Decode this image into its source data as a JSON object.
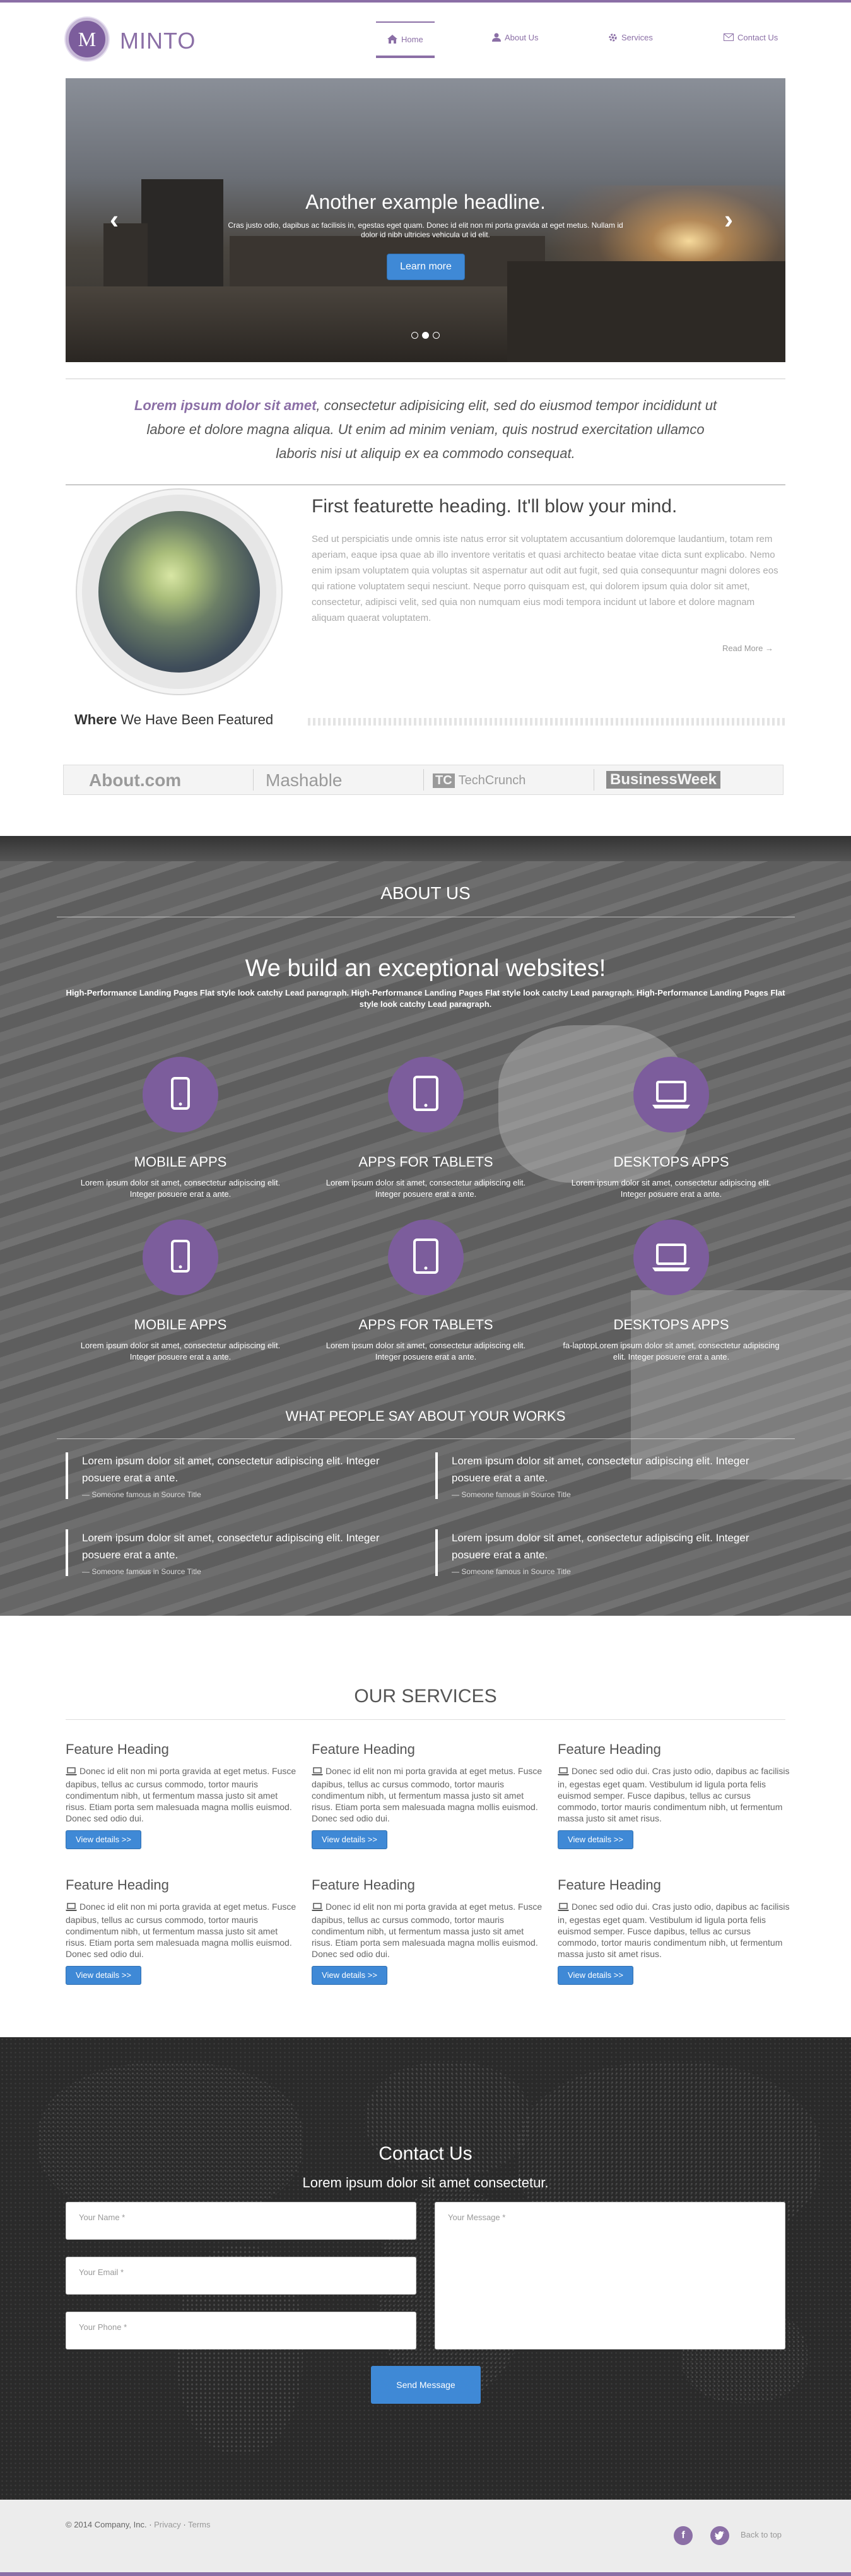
{
  "brand": {
    "logo_letter": "M",
    "name": "MINTO",
    "accent": "#8b6fa6",
    "button": "#3f89d6"
  },
  "nav": [
    {
      "label": "Home",
      "icon": "home-icon"
    },
    {
      "label": "About Us",
      "icon": "user-icon"
    },
    {
      "label": "Services",
      "icon": "gear-icon"
    },
    {
      "label": "Contact Us",
      "icon": "envelope-icon"
    }
  ],
  "carousel": {
    "headline": "Another example headline.",
    "text": "Cras justo odio, dapibus ac facilisis in, egestas eget quam. Donec id elit non mi porta gravida at eget metus. Nullam id dolor id nibh ultricies vehicula ut id elit.",
    "button": "Learn more",
    "slide_count": 3,
    "active_slide": 2
  },
  "lead_quote": {
    "bold": "Lorem ipsum dolor sit amet",
    "text": ", consectetur adipisicing elit, sed do eiusmod tempor incididunt ut labore et dolore magna aliqua. Ut enim ad minim veniam, quis nostrud exercitation ullamco laboris nisi ut aliquip ex ea commodo consequat."
  },
  "featurette": {
    "heading": "First featurette heading. It'll blow your mind.",
    "text": "Sed ut perspiciatis unde omnis iste natus error sit voluptatem accusantium doloremque laudantium, totam rem aperiam, eaque ipsa quae ab illo inventore veritatis et quasi architecto beatae vitae dicta sunt explicabo. Nemo enim ipsam voluptatem quia voluptas sit aspernatur aut odit aut fugit, sed quia consequuntur magni dolores eos qui ratione voluptatem sequi nesciunt. Neque porro quisquam est, qui dolorem ipsum quia dolor sit amet, consectetur, adipisci velit, sed quia non numquam eius modi tempora incidunt ut labore et dolore magnam aliquam quaerat voluptatem.",
    "read_more": "Read More"
  },
  "featured": {
    "bold": "Where",
    "rest": " We Have Been Featured",
    "logos": [
      "About.com",
      "Mashable",
      "TechCrunch",
      "BusinessWeek"
    ]
  },
  "about": {
    "title": "ABOUT US",
    "headline": "We build an exceptional websites!",
    "lead": "High-Performance Landing Pages Flat style look catchy Lead paragraph. High-Performance Landing Pages Flat style look catchy Lead paragraph. High-Performance Landing Pages Flat style look catchy Lead paragraph.",
    "services": [
      {
        "icon": "mobile-icon",
        "title": "MOBILE APPS",
        "text": "Lorem ipsum dolor sit amet, consectetur adipiscing elit. Integer posuere erat a ante."
      },
      {
        "icon": "tablet-icon",
        "title": "APPS FOR TABLETS",
        "text": "Lorem ipsum dolor sit amet, consectetur adipiscing elit. Integer posuere erat a ante."
      },
      {
        "icon": "laptop-icon",
        "title": "DESKTOPS APPS",
        "text": "Lorem ipsum dolor sit amet, consectetur adipiscing elit. Integer posuere erat a ante."
      },
      {
        "icon": "mobile-icon",
        "title": "MOBILE APPS",
        "text": "Lorem ipsum dolor sit amet, consectetur adipiscing elit. Integer posuere erat a ante."
      },
      {
        "icon": "tablet-icon",
        "title": "APPS FOR TABLETS",
        "text": "Lorem ipsum dolor sit amet, consectetur adipiscing elit. Integer posuere erat a ante."
      },
      {
        "icon": "laptop-icon",
        "title": "DESKTOPS APPS",
        "text": "fa-laptopLorem ipsum dolor sit amet, consectetur adipiscing elit. Integer posuere erat a ante."
      }
    ],
    "testimonials_title": "WHAT PEOPLE SAY ABOUT YOUR WORKS",
    "testimonials": [
      {
        "quote": "Lorem ipsum dolor sit amet, consectetur adipiscing elit. Integer posuere erat a ante.",
        "source": "— Someone famous in Source Title"
      },
      {
        "quote": "Lorem ipsum dolor sit amet, consectetur adipiscing elit. Integer posuere erat a ante.",
        "source": "— Someone famous in Source Title"
      },
      {
        "quote": "Lorem ipsum dolor sit amet, consectetur adipiscing elit. Integer posuere erat a ante.",
        "source": "— Someone famous in Source Title"
      },
      {
        "quote": "Lorem ipsum dolor sit amet, consectetur adipiscing elit. Integer posuere erat a ante.",
        "source": "— Someone famous in Source Title"
      }
    ]
  },
  "services": {
    "title": "OUR SERVICES",
    "cards": [
      {
        "heading": "Feature Heading",
        "text": "Donec id elit non mi porta gravida at eget metus. Fusce dapibus, tellus ac cursus commodo, tortor mauris condimentum nibh, ut fermentum massa justo sit amet risus. Etiam porta sem malesuada magna mollis euismod. Donec sed odio dui.",
        "button": "View details >>"
      },
      {
        "heading": "Feature Heading",
        "text": "Donec id elit non mi porta gravida at eget metus. Fusce dapibus, tellus ac cursus commodo, tortor mauris condimentum nibh, ut fermentum massa justo sit amet risus. Etiam porta sem malesuada magna mollis euismod. Donec sed odio dui.",
        "button": "View details >>"
      },
      {
        "heading": "Feature Heading",
        "text": "Donec sed odio dui. Cras justo odio, dapibus ac facilisis in, egestas eget quam. Vestibulum id ligula porta felis euismod semper. Fusce dapibus, tellus ac cursus commodo, tortor mauris condimentum nibh, ut fermentum massa justo sit amet risus.",
        "button": "View details >>"
      },
      {
        "heading": "Feature Heading",
        "text": "Donec id elit non mi porta gravida at eget metus. Fusce dapibus, tellus ac cursus commodo, tortor mauris condimentum nibh, ut fermentum massa justo sit amet risus. Etiam porta sem malesuada magna mollis euismod. Donec sed odio dui.",
        "button": "View details >>"
      },
      {
        "heading": "Feature Heading",
        "text": "Donec id elit non mi porta gravida at eget metus. Fusce dapibus, tellus ac cursus commodo, tortor mauris condimentum nibh, ut fermentum massa justo sit amet risus. Etiam porta sem malesuada magna mollis euismod. Donec sed odio dui.",
        "button": "View details >>"
      },
      {
        "heading": "Feature Heading",
        "text": "Donec sed odio dui. Cras justo odio, dapibus ac facilisis in, egestas eget quam. Vestibulum id ligula porta felis euismod semper. Fusce dapibus, tellus ac cursus commodo, tortor mauris condimentum nibh, ut fermentum massa justo sit amet risus.",
        "button": "View details >>"
      }
    ]
  },
  "contact": {
    "title": "Contact Us",
    "lead": "Lorem ipsum dolor sit amet consectetur.",
    "name_placeholder": "Your Name *",
    "email_placeholder": "Your Email *",
    "phone_placeholder": "Your Phone *",
    "message_placeholder": "Your Message *",
    "send": "Send Message"
  },
  "footer": {
    "copyright": "© 2014 Company, Inc.",
    "privacy": "Privacy",
    "terms": "Terms",
    "facebook": "f",
    "back_to_top": "Back to top"
  }
}
